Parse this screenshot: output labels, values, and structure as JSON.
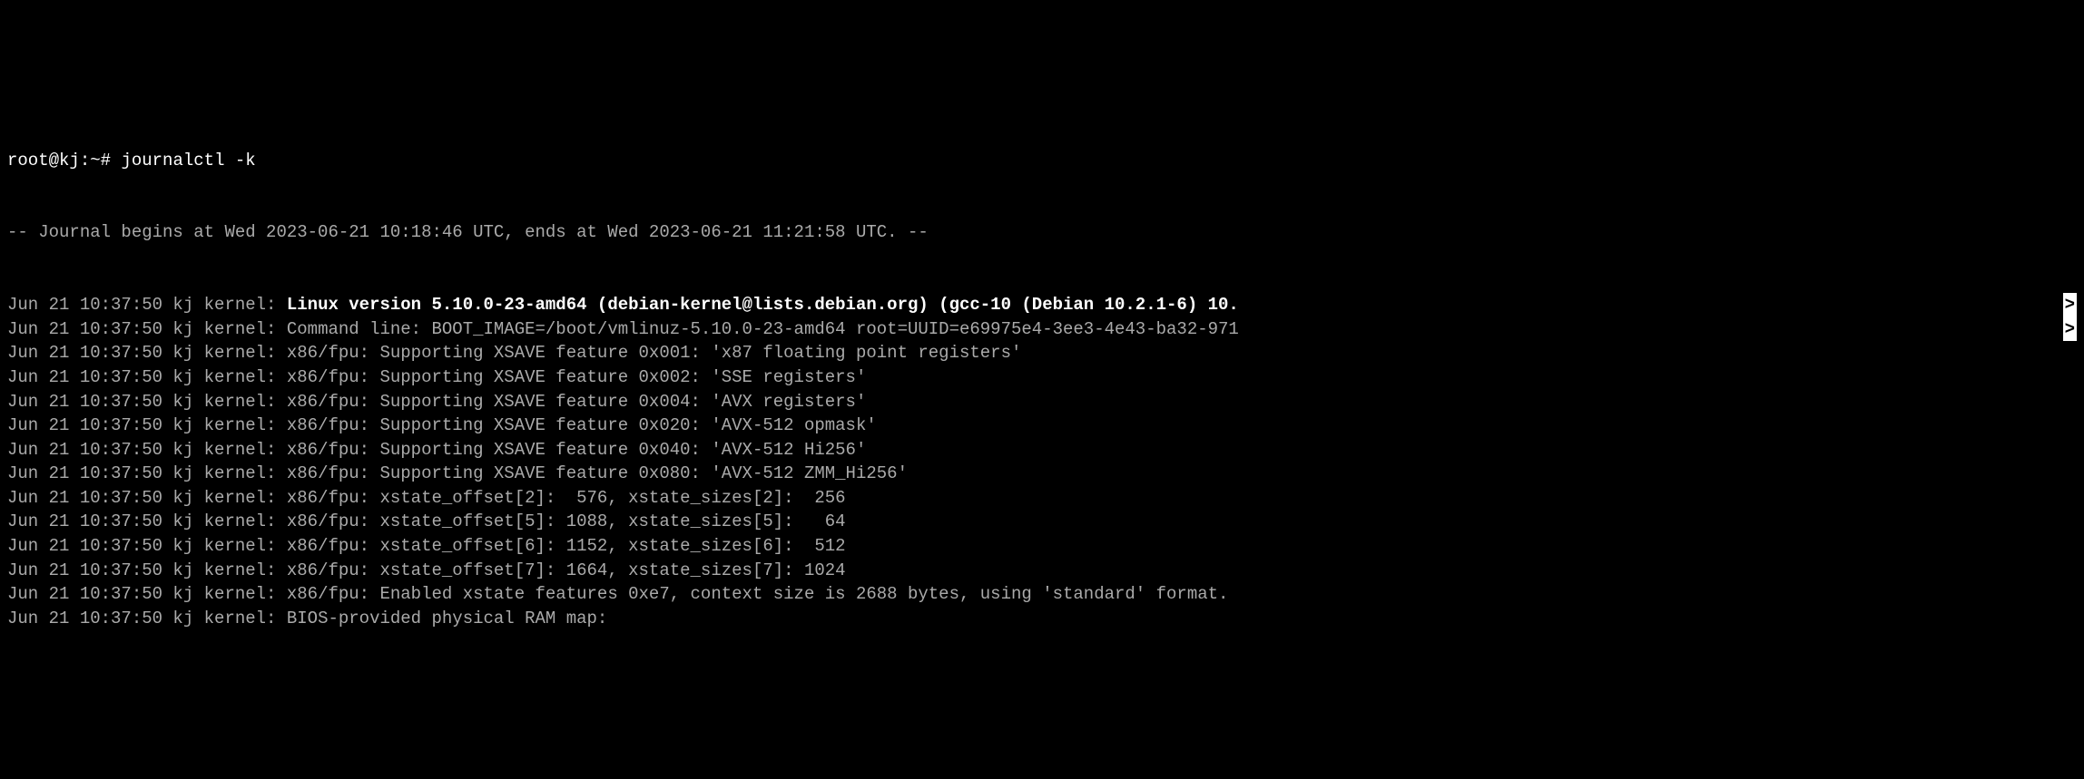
{
  "prompt": {
    "user_host": "root@kj",
    "path": "~",
    "symbol": "#",
    "command": "journalctl -k"
  },
  "header": "-- Journal begins at Wed 2023-06-21 10:18:46 UTC, ends at Wed 2023-06-21 11:21:58 UTC. --",
  "lines": [
    {
      "prefix": "Jun 21 10:37:50 kj kernel: ",
      "msg": "Linux version 5.10.0-23-amd64 (debian-kernel@lists.debian.org) (gcc-10 (Debian 10.2.1-6) 10.",
      "bold": true,
      "scroll": ">"
    },
    {
      "prefix": "Jun 21 10:37:50 kj kernel: ",
      "msg": "Command line: BOOT_IMAGE=/boot/vmlinuz-5.10.0-23-amd64 root=UUID=e69975e4-3ee3-4e43-ba32-971",
      "bold": false,
      "scroll": ">"
    },
    {
      "prefix": "Jun 21 10:37:50 kj kernel: ",
      "msg": "x86/fpu: Supporting XSAVE feature 0x001: 'x87 floating point registers'",
      "bold": false,
      "scroll": ""
    },
    {
      "prefix": "Jun 21 10:37:50 kj kernel: ",
      "msg": "x86/fpu: Supporting XSAVE feature 0x002: 'SSE registers'",
      "bold": false,
      "scroll": ""
    },
    {
      "prefix": "Jun 21 10:37:50 kj kernel: ",
      "msg": "x86/fpu: Supporting XSAVE feature 0x004: 'AVX registers'",
      "bold": false,
      "scroll": ""
    },
    {
      "prefix": "Jun 21 10:37:50 kj kernel: ",
      "msg": "x86/fpu: Supporting XSAVE feature 0x020: 'AVX-512 opmask'",
      "bold": false,
      "scroll": ""
    },
    {
      "prefix": "Jun 21 10:37:50 kj kernel: ",
      "msg": "x86/fpu: Supporting XSAVE feature 0x040: 'AVX-512 Hi256'",
      "bold": false,
      "scroll": ""
    },
    {
      "prefix": "Jun 21 10:37:50 kj kernel: ",
      "msg": "x86/fpu: Supporting XSAVE feature 0x080: 'AVX-512 ZMM_Hi256'",
      "bold": false,
      "scroll": ""
    },
    {
      "prefix": "Jun 21 10:37:50 kj kernel: ",
      "msg": "x86/fpu: xstate_offset[2]:  576, xstate_sizes[2]:  256",
      "bold": false,
      "scroll": ""
    },
    {
      "prefix": "Jun 21 10:37:50 kj kernel: ",
      "msg": "x86/fpu: xstate_offset[5]: 1088, xstate_sizes[5]:   64",
      "bold": false,
      "scroll": ""
    },
    {
      "prefix": "Jun 21 10:37:50 kj kernel: ",
      "msg": "x86/fpu: xstate_offset[6]: 1152, xstate_sizes[6]:  512",
      "bold": false,
      "scroll": ""
    },
    {
      "prefix": "Jun 21 10:37:50 kj kernel: ",
      "msg": "x86/fpu: xstate_offset[7]: 1664, xstate_sizes[7]: 1024",
      "bold": false,
      "scroll": ""
    },
    {
      "prefix": "Jun 21 10:37:50 kj kernel: ",
      "msg": "x86/fpu: Enabled xstate features 0xe7, context size is 2688 bytes, using 'standard' format.",
      "bold": false,
      "scroll": ""
    },
    {
      "prefix": "Jun 21 10:37:50 kj kernel: ",
      "msg": "BIOS-provided physical RAM map:",
      "bold": false,
      "scroll": ""
    }
  ]
}
